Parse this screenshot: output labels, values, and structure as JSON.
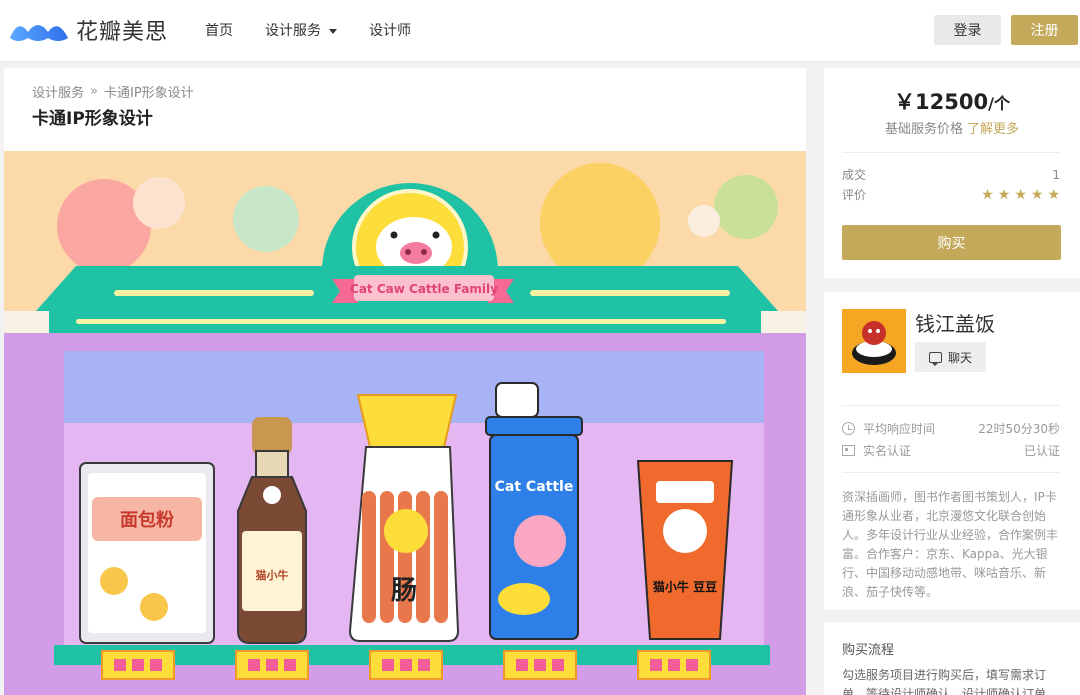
{
  "header": {
    "logo_main": "花瓣",
    "logo_sub": "美思",
    "nav": {
      "home": "首页",
      "design_services": "设计服务",
      "designers": "设计师"
    },
    "login": "登录",
    "register": "注册"
  },
  "breadcrumb": {
    "root": "设计服务",
    "sep": "»",
    "current": "卡通IP形象设计"
  },
  "page_title": "卡通IP形象设计",
  "hero": {
    "banner_text": "Cat Caw Cattle Family",
    "products": {
      "flour_label": "面包粉",
      "can_label": "Cat Cattle",
      "sausage_label": "肠",
      "bottle_label": "猫小牛",
      "tube_label": "猫小牛 豆豆"
    }
  },
  "price_card": {
    "price": "￥12500",
    "unit": "/个",
    "price_note": "基础服务价格",
    "learn_more": "了解更多",
    "deals_label": "成交",
    "deals_value": "1",
    "rating_label": "评价",
    "rating_stars": 5,
    "buy_button": "购买"
  },
  "shop_card": {
    "name": "钱江盖饭",
    "chat_button": "聊天",
    "response_label": "平均响应时间",
    "response_value": "22时50分30秒",
    "verify_label": "实名认证",
    "verify_value": "已认证",
    "bio": "资深插画师，图书作者图书策划人，IP卡通形象从业者，北京漫悠文化联合创始人。多年设计行业从业经验，合作案例丰富。合作客户：京东、Kappa、光大银行、中国移动动感地带、咪咕音乐、新浪、茄子快传等。"
  },
  "flow_card": {
    "title": "购买流程",
    "text": "勾选服务项目进行购买后，填写需求订单，等待设计师确认，设计师确认订单"
  },
  "colors": {
    "gold": "#c4a95a",
    "teal": "#1fc2a5",
    "shelf_purple": "#d69be8"
  }
}
